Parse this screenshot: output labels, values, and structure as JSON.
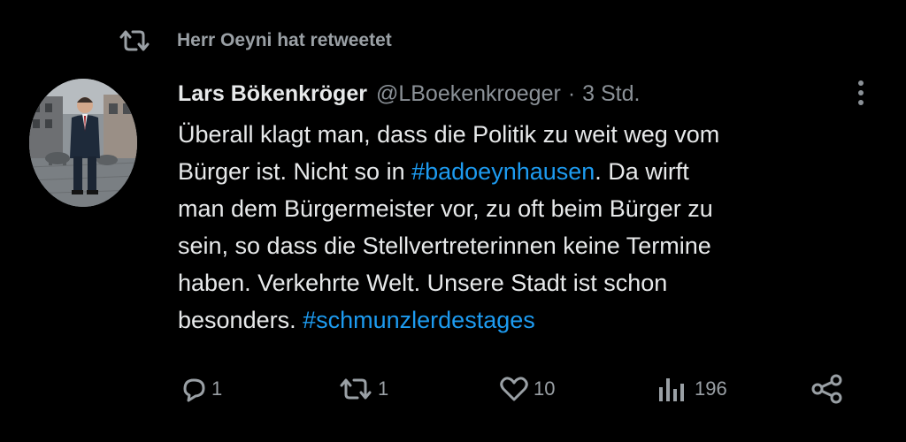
{
  "retweet_banner": {
    "icon": "retweet-icon",
    "text": "Herr Oeyni hat retweetet"
  },
  "tweet": {
    "author_name": "Lars Bökenkröger",
    "handle": "@LBoekenkroeger",
    "separator": "·",
    "time": "3 Std.",
    "lines": [
      [
        {
          "text": "Überall klagt man, dass die Politik zu weit weg vom"
        }
      ],
      [
        {
          "text": "Bürger ist. Nicht so in "
        },
        {
          "text": "#badoeynhausen",
          "hashtag": true
        },
        {
          "text": ". Da wirft"
        }
      ],
      [
        {
          "text": "man dem Bürgermeister vor, zu oft beim Bürger zu"
        }
      ],
      [
        {
          "text": "sein, so dass die Stellvertreterinnen keine Termine"
        }
      ],
      [
        {
          "text": "haben. Verkehrte Welt. Unsere Stadt ist schon"
        }
      ],
      [
        {
          "text": "besonders. "
        },
        {
          "text": "#schmunzlerdestages",
          "hashtag": true
        }
      ]
    ]
  },
  "actions": {
    "reply_count": "1",
    "retweet_count": "1",
    "like_count": "10",
    "views_count": "196"
  },
  "colors": {
    "background": "#000000",
    "text": "#e7e9ea",
    "secondary": "#8b9197",
    "hashtag": "#1d9bf0"
  }
}
